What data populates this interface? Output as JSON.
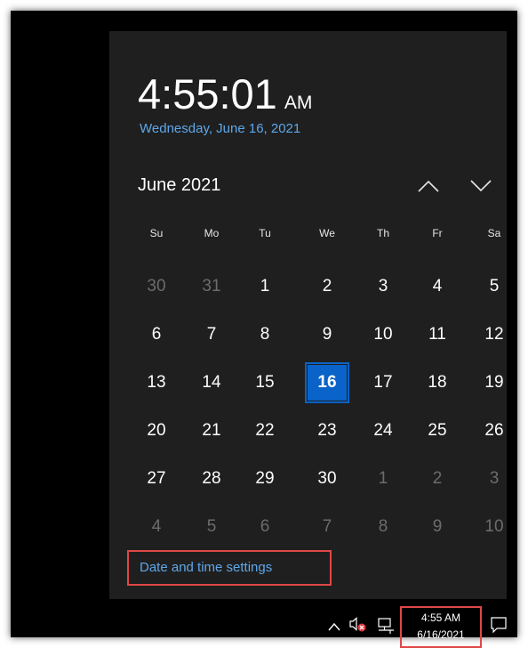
{
  "flyout": {
    "time": "4:55:01",
    "ampm": "AM",
    "long_date": "Wednesday, June 16, 2021",
    "month_label": "June 2021",
    "nav": {
      "prev_icon": "chevron-up-icon",
      "next_icon": "chevron-down-icon"
    },
    "weekdays": [
      "Su",
      "Mo",
      "Tu",
      "We",
      "Th",
      "Fr",
      "Sa"
    ],
    "weeks": [
      [
        {
          "d": "30",
          "other": true
        },
        {
          "d": "31",
          "other": true
        },
        {
          "d": "1"
        },
        {
          "d": "2"
        },
        {
          "d": "3"
        },
        {
          "d": "4"
        },
        {
          "d": "5"
        }
      ],
      [
        {
          "d": "6"
        },
        {
          "d": "7"
        },
        {
          "d": "8"
        },
        {
          "d": "9"
        },
        {
          "d": "10"
        },
        {
          "d": "11"
        },
        {
          "d": "12"
        }
      ],
      [
        {
          "d": "13"
        },
        {
          "d": "14"
        },
        {
          "d": "15"
        },
        {
          "d": "16",
          "today": true
        },
        {
          "d": "17"
        },
        {
          "d": "18"
        },
        {
          "d": "19"
        }
      ],
      [
        {
          "d": "20"
        },
        {
          "d": "21"
        },
        {
          "d": "22"
        },
        {
          "d": "23"
        },
        {
          "d": "24"
        },
        {
          "d": "25"
        },
        {
          "d": "26"
        }
      ],
      [
        {
          "d": "27"
        },
        {
          "d": "28"
        },
        {
          "d": "29"
        },
        {
          "d": "30"
        },
        {
          "d": "1",
          "other": true
        },
        {
          "d": "2",
          "other": true
        },
        {
          "d": "3",
          "other": true
        }
      ],
      [
        {
          "d": "4",
          "other": true
        },
        {
          "d": "5",
          "other": true
        },
        {
          "d": "6",
          "other": true
        },
        {
          "d": "7",
          "other": true
        },
        {
          "d": "8",
          "other": true
        },
        {
          "d": "9",
          "other": true
        },
        {
          "d": "10",
          "other": true
        }
      ]
    ],
    "settings_link": "Date and time settings"
  },
  "taskbar": {
    "time": "4:55 AM",
    "date": "6/16/2021",
    "icons": [
      "chevron-up-icon",
      "speaker-muted-icon",
      "network-icon",
      "action-center-icon"
    ]
  },
  "colors": {
    "flyout_bg": "#1f1f1f",
    "accent": "#0a63c8",
    "link": "#5ea7ea",
    "highlight_box": "#e04747"
  }
}
